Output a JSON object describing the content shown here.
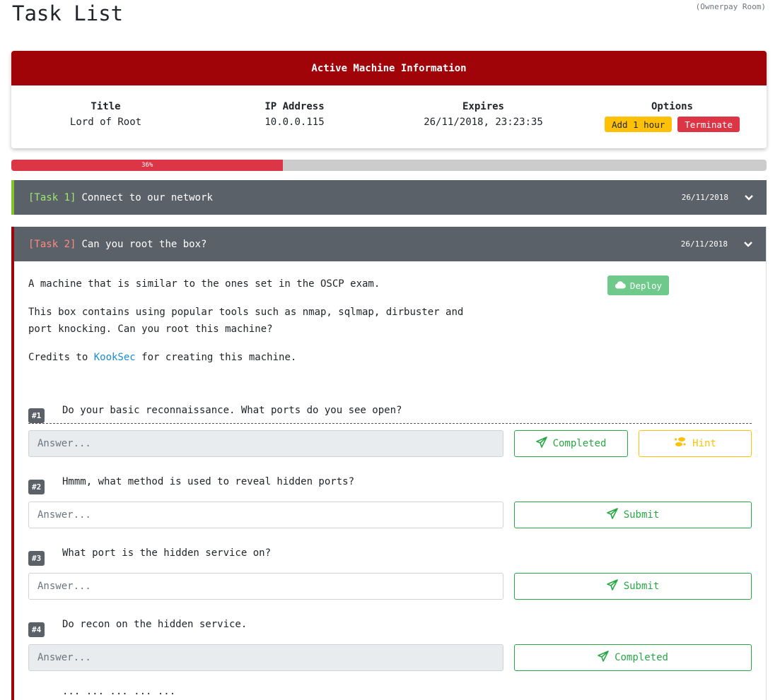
{
  "page": {
    "title": "Task List",
    "room_tag": "(Ownerpay Room)"
  },
  "machine": {
    "header": "Active Machine Information",
    "columns": [
      {
        "heading": "Title",
        "value": "Lord of Root"
      },
      {
        "heading": "IP Address",
        "value": "10.0.0.115"
      },
      {
        "heading": "Expires",
        "value": "26/11/2018, 23:23:35"
      },
      {
        "heading": "Options"
      }
    ],
    "add_hour_label": "Add 1 hour",
    "terminate_label": "Terminate"
  },
  "progress": {
    "percent": 36,
    "label": "36%"
  },
  "tasks": [
    {
      "number": "[Task 1]",
      "title": "Connect to our network",
      "date": "26/11/2018"
    },
    {
      "number": "[Task 2]",
      "title": "Can you root the box?",
      "date": "26/11/2018",
      "desc1": "A machine that is similar to the ones set in the OSCP exam.",
      "desc2": "This box contains using popular tools such as nmap, sqlmap, dirbuster and port knocking. Can you root this machine?",
      "desc3_prefix": "Credits to ",
      "desc3_link": "KookSec",
      "desc3_suffix": " for creating this machine.",
      "deploy_label": "Deploy"
    }
  ],
  "questions": [
    {
      "badge": "#1",
      "text": "Do your basic reconnaissance. What ports do you see open?",
      "placeholder": "Answer...",
      "button": "Completed",
      "hint": "Hint"
    },
    {
      "badge": "#2",
      "text": "Hmmm, what method is used to reveal hidden ports?",
      "placeholder": "Answer...",
      "button": "Submit"
    },
    {
      "badge": "#3",
      "text": "What port is the hidden service on?",
      "placeholder": "Answer...",
      "button": "Submit"
    },
    {
      "badge": "#4",
      "text": "Do recon on the hidden service.",
      "placeholder": "Answer...",
      "button": "Completed"
    }
  ],
  "q5_partial": "...           ...  ...  ...  ..."
}
